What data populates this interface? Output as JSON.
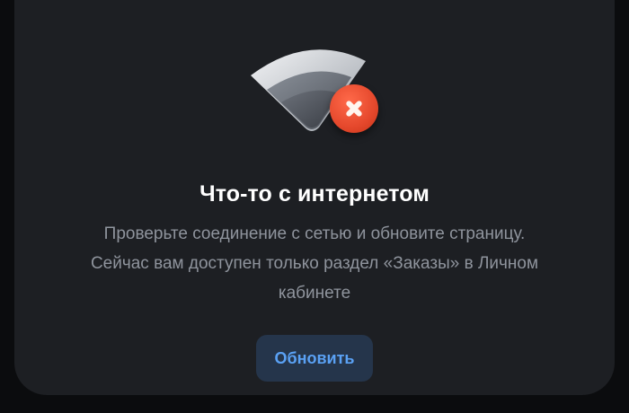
{
  "icons": {
    "wifi": "wifi-icon",
    "error": "error-x-icon"
  },
  "colors": {
    "card_background": "#1d1f23",
    "title": "#ffffff",
    "description": "#8f949d",
    "button_background": "#25354b",
    "button_text": "#5aa1f4",
    "error_badge": "#e5482c"
  },
  "error": {
    "title": "Что-то с интернетом",
    "description_lines": [
      "Проверьте соединение с сетью и обновите страницу.",
      "Сейчас вам доступен только раздел «Заказы» в Личном",
      "кабинете"
    ],
    "refresh_label": "Обновить"
  }
}
